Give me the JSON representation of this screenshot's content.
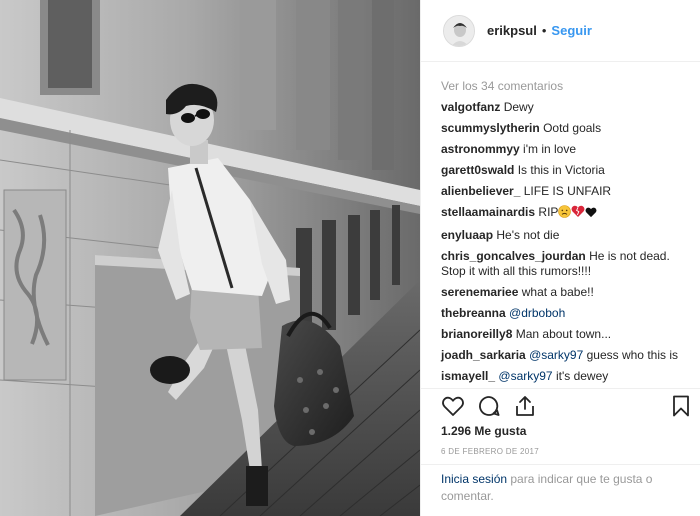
{
  "post": {
    "username": "erikpsul",
    "separator": "•",
    "follow_label": "Seguir"
  },
  "comments": {
    "view_all": "Ver los 34 comentarios",
    "items": [
      {
        "user": "valgotfanz",
        "text": "Dewy"
      },
      {
        "user": "scummyslytherin",
        "text": "Ootd goals"
      },
      {
        "user": "astronommyy",
        "text": "i'm in love"
      },
      {
        "user": "garett0swald",
        "text": "Is this in Victoria"
      },
      {
        "user": "alienbeliever_",
        "text": "LIFE IS UNFAIR"
      },
      {
        "user": "stellaamainardis",
        "text": "RIP"
      },
      {
        "user": "enyluaap",
        "text": "He's not die"
      },
      {
        "user": "chris_goncalves_jourdan",
        "text": "He is not dead. Stop it with all this rumors!!!!"
      },
      {
        "user": "serenemariee",
        "text": "what a babe!!"
      },
      {
        "user": "thebreanna",
        "mention": "@drboboh",
        "text": ""
      },
      {
        "user": "brianoreilly8",
        "text": "Man about town..."
      },
      {
        "user": "joadh_sarkaria",
        "mention": "@sarky97",
        "text": "guess who this is"
      },
      {
        "user": "ismayell_",
        "mention": "@sarky97",
        "text": "it's dewey"
      }
    ]
  },
  "stellaa_emojis": [
    "disappointed-face-icon",
    "broken-heart-icon",
    "black-heart-icon"
  ],
  "likes": "1.296 Me gusta",
  "date": "6 DE FEBRERO DE 2017",
  "login": {
    "link": "Inicia sesión",
    "text": " para indicar que te gusta o comentar."
  },
  "icons": {
    "like": "heart-outline-icon",
    "comment": "speech-bubble-icon",
    "share": "share-upload-icon",
    "save": "bookmark-icon"
  },
  "colors": {
    "link_blue": "#3897f0",
    "mention_blue": "#003569",
    "muted": "#999999",
    "text": "#262626"
  }
}
